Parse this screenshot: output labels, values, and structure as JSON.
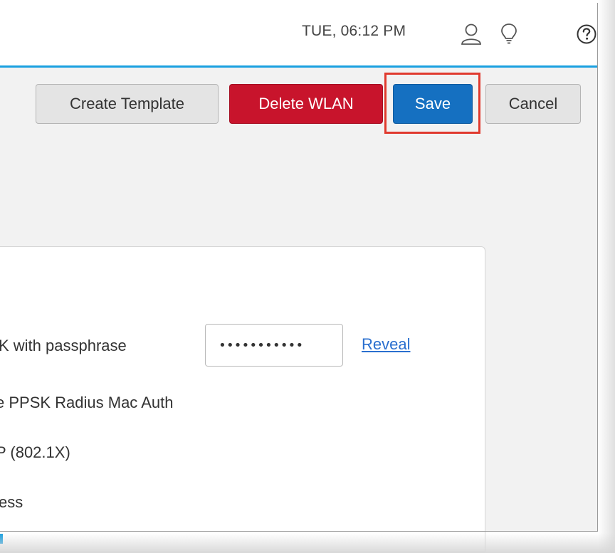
{
  "header": {
    "datetime": "TUE, 06:12 PM",
    "icons": {
      "user": "user-icon",
      "tips": "lightbulb-icon",
      "help": "help-icon"
    },
    "accent_color": "#1aa0e0"
  },
  "toolbar": {
    "create_template_label": "Create Template",
    "delete_wlan_label": "Delete WLAN",
    "save_label": "Save",
    "cancel_label": "Cancel",
    "delete_color": "#c8142c",
    "save_color": "#1570c1",
    "highlight_color": "#e03a2e"
  },
  "security": {
    "psk_option_label": "K with passphrase",
    "passphrase_value": "•••••••••••",
    "reveal_label": "Reveal",
    "ppsk_option_label": "e PPSK Radius Mac Auth",
    "eap_option_label": "P (802.1X)",
    "open_option_label": "ess"
  }
}
